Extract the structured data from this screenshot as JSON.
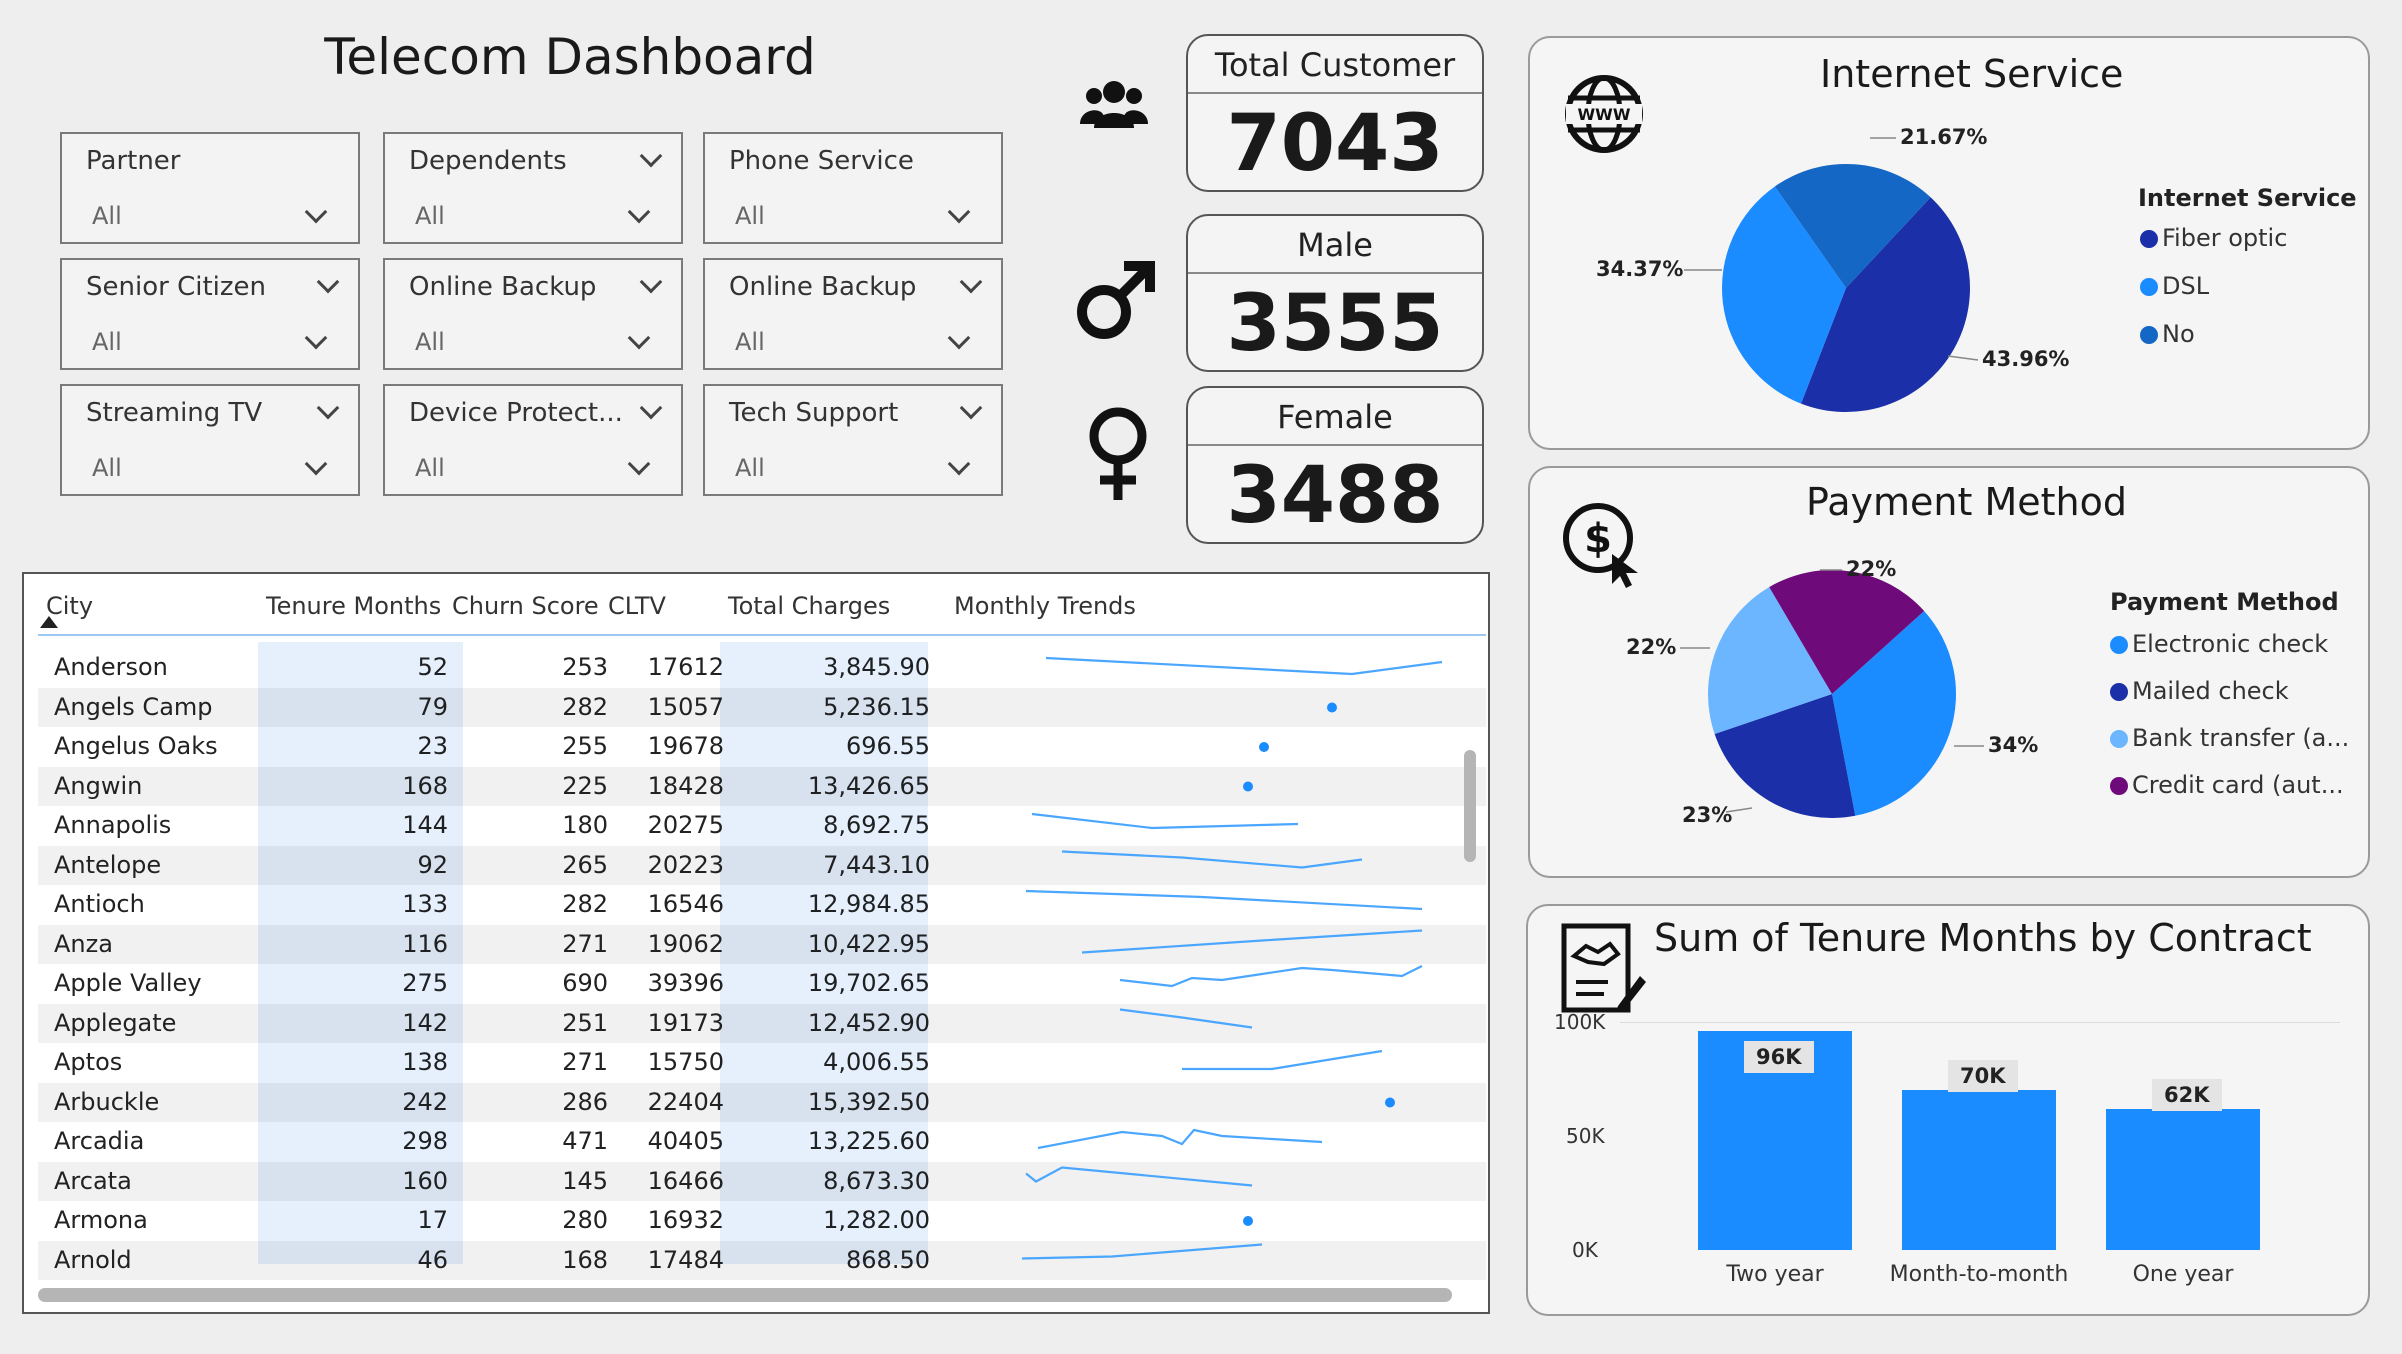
{
  "title": "Telecom Dashboard",
  "slicers": [
    {
      "label": "Partner",
      "value": "All"
    },
    {
      "label": "Dependents",
      "value": "All"
    },
    {
      "label": "Phone Service",
      "value": "All"
    },
    {
      "label": "Senior Citizen",
      "value": "All"
    },
    {
      "label": "Online Backup",
      "value": "All"
    },
    {
      "label": "Online Backup",
      "value": "All"
    },
    {
      "label": "Streaming TV",
      "value": "All"
    },
    {
      "label": "Device Protect...",
      "value": "All"
    },
    {
      "label": "Tech Support",
      "value": "All"
    }
  ],
  "kpis": {
    "total": {
      "label": "Total Customer",
      "value": "7043",
      "icon": "users-icon"
    },
    "male": {
      "label": "Male",
      "value": "3555",
      "icon": "male-icon"
    },
    "female": {
      "label": "Female",
      "value": "3488",
      "icon": "female-icon"
    }
  },
  "internet": {
    "title": "Internet Service",
    "icon": "www-globe-icon",
    "legend_title": "Internet Service",
    "legend": [
      {
        "label": "Fiber optic",
        "color": "#1a2fa8"
      },
      {
        "label": "DSL",
        "color": "#1a8cff"
      },
      {
        "label": "No",
        "color": "#1467c4"
      }
    ],
    "pct_labels": [
      "21.67%",
      "34.37%",
      "43.96%"
    ]
  },
  "payment": {
    "title": "Payment Method",
    "icon": "dollar-click-icon",
    "legend_title": "Payment Method",
    "legend": [
      {
        "label": "Electronic check",
        "color": "#1a8cff"
      },
      {
        "label": "Mailed check",
        "color": "#1a2fa8"
      },
      {
        "label": "Bank transfer (a...",
        "color": "#6bb6ff"
      },
      {
        "label": "Credit card (aut...",
        "color": "#6e0a7a"
      }
    ],
    "pct_labels": [
      "22%",
      "22%",
      "34%",
      "23%"
    ]
  },
  "contract": {
    "title": "Sum of Tenure Months by Contract",
    "icon": "contract-icon",
    "y_ticks": [
      "100K",
      "50K",
      "0K"
    ],
    "bar_labels": [
      "96K",
      "70K",
      "62K"
    ]
  },
  "table": {
    "columns": [
      "City",
      "Tenure Months",
      "Churn Score",
      "CLTV",
      "Total Charges",
      "Monthly Trends"
    ],
    "rows": [
      {
        "city": "Anderson",
        "tenure": "52",
        "churn": "253",
        "cltv": "17612",
        "charges": "3,845.90"
      },
      {
        "city": "Angels Camp",
        "tenure": "79",
        "churn": "282",
        "cltv": "15057",
        "charges": "5,236.15"
      },
      {
        "city": "Angelus Oaks",
        "tenure": "23",
        "churn": "255",
        "cltv": "19678",
        "charges": "696.55"
      },
      {
        "city": "Angwin",
        "tenure": "168",
        "churn": "225",
        "cltv": "18428",
        "charges": "13,426.65"
      },
      {
        "city": "Annapolis",
        "tenure": "144",
        "churn": "180",
        "cltv": "20275",
        "charges": "8,692.75"
      },
      {
        "city": "Antelope",
        "tenure": "92",
        "churn": "265",
        "cltv": "20223",
        "charges": "7,443.10"
      },
      {
        "city": "Antioch",
        "tenure": "133",
        "churn": "282",
        "cltv": "16546",
        "charges": "12,984.85"
      },
      {
        "city": "Anza",
        "tenure": "116",
        "churn": "271",
        "cltv": "19062",
        "charges": "10,422.95"
      },
      {
        "city": "Apple Valley",
        "tenure": "275",
        "churn": "690",
        "cltv": "39396",
        "charges": "19,702.65"
      },
      {
        "city": "Applegate",
        "tenure": "142",
        "churn": "251",
        "cltv": "19173",
        "charges": "12,452.90"
      },
      {
        "city": "Aptos",
        "tenure": "138",
        "churn": "271",
        "cltv": "15750",
        "charges": "4,006.55"
      },
      {
        "city": "Arbuckle",
        "tenure": "242",
        "churn": "286",
        "cltv": "22404",
        "charges": "15,392.50"
      },
      {
        "city": "Arcadia",
        "tenure": "298",
        "churn": "471",
        "cltv": "40405",
        "charges": "13,225.60"
      },
      {
        "city": "Arcata",
        "tenure": "160",
        "churn": "145",
        "cltv": "16466",
        "charges": "8,673.30"
      },
      {
        "city": "Armona",
        "tenure": "17",
        "churn": "280",
        "cltv": "16932",
        "charges": "1,282.00"
      },
      {
        "city": "Arnold",
        "tenure": "46",
        "churn": "168",
        "cltv": "17484",
        "charges": "868.50"
      }
    ]
  },
  "chart_data": [
    {
      "type": "pie",
      "title": "Internet Service",
      "categories": [
        "Fiber optic",
        "DSL",
        "No"
      ],
      "values": [
        43.96,
        34.37,
        21.67
      ],
      "colors": [
        "#1a2fa8",
        "#1a8cff",
        "#1467c4"
      ],
      "legend": "right"
    },
    {
      "type": "pie",
      "title": "Payment Method",
      "categories": [
        "Electronic check",
        "Mailed check",
        "Bank transfer (a...",
        "Credit card (aut..."
      ],
      "values": [
        34,
        23,
        22,
        22
      ],
      "colors": [
        "#1a8cff",
        "#1a2fa8",
        "#6bb6ff",
        "#6e0a7a"
      ],
      "legend": "right"
    },
    {
      "type": "bar",
      "title": "Sum of Tenure Months by Contract",
      "categories": [
        "Two year",
        "Month-to-month",
        "One year"
      ],
      "values": [
        96000,
        70000,
        62000
      ],
      "ylim": [
        0,
        100000
      ]
    }
  ]
}
